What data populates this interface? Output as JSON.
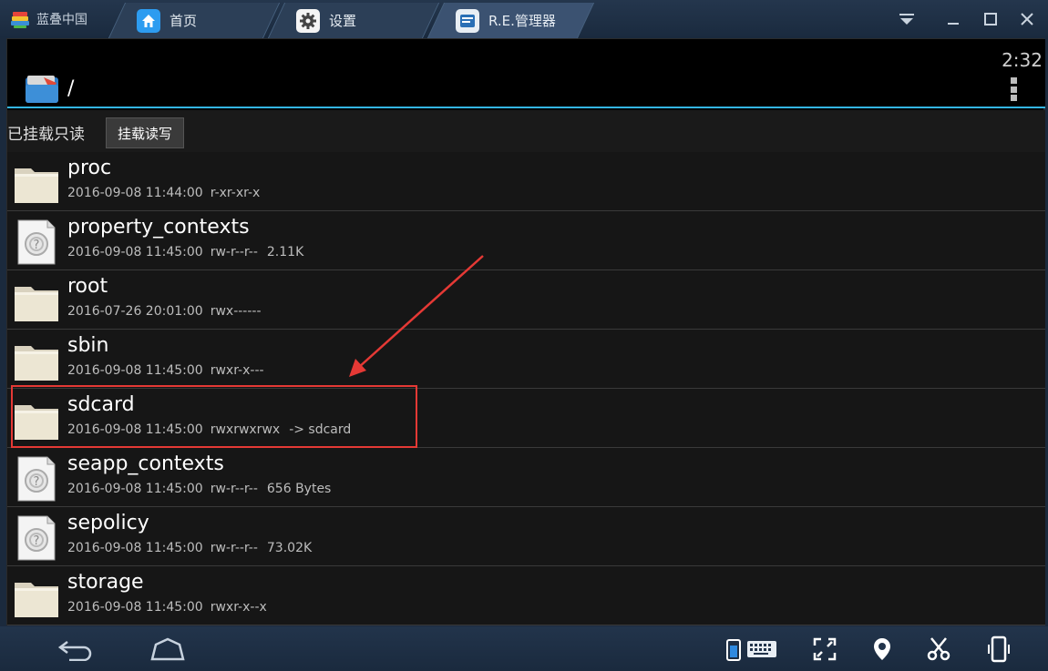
{
  "titlebar": {
    "brand": "蓝叠中国",
    "tabs": [
      {
        "label": "首页",
        "icon": "home-icon"
      },
      {
        "label": "设置",
        "icon": "gear-icon"
      },
      {
        "label": "R.E.管理器",
        "icon": "file-manager-icon"
      }
    ]
  },
  "actionbar": {
    "time": "2:32",
    "path": "/"
  },
  "mountbar": {
    "status": "已挂载只读",
    "button": "挂载读写"
  },
  "files": [
    {
      "name": "proc",
      "date": "2016-09-08 11:44:00",
      "perms": "r-xr-xr-x",
      "extra": "",
      "type": "folder"
    },
    {
      "name": "property_contexts",
      "date": "2016-09-08 11:45:00",
      "perms": "rw-r--r--",
      "extra": "2.11K",
      "type": "file"
    },
    {
      "name": "root",
      "date": "2016-07-26 20:01:00",
      "perms": "rwx------",
      "extra": "",
      "type": "folder"
    },
    {
      "name": "sbin",
      "date": "2016-09-08 11:45:00",
      "perms": "rwxr-x---",
      "extra": "",
      "type": "folder"
    },
    {
      "name": "sdcard",
      "date": "2016-09-08 11:45:00",
      "perms": "rwxrwxrwx",
      "extra": "-> sdcard",
      "type": "folder"
    },
    {
      "name": "seapp_contexts",
      "date": "2016-09-08 11:45:00",
      "perms": "rw-r--r--",
      "extra": "656 Bytes",
      "type": "file"
    },
    {
      "name": "sepolicy",
      "date": "2016-09-08 11:45:00",
      "perms": "rw-r--r--",
      "extra": "73.02K",
      "type": "file"
    },
    {
      "name": "storage",
      "date": "2016-09-08 11:45:00",
      "perms": "rwxr-x--x",
      "extra": "",
      "type": "folder"
    }
  ],
  "colors": {
    "accent": "#33b5e5",
    "highlight": "#e53935"
  }
}
